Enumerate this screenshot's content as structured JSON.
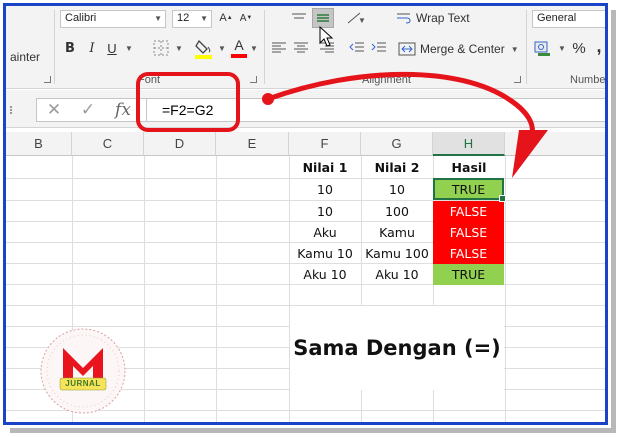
{
  "ribbon": {
    "font_name": "Calibri",
    "font_size": "12",
    "font_group_label": "Font",
    "alignment_group_label": "Alignment",
    "number_group_label": "Number",
    "painter_label": "ainter",
    "bold_label": "B",
    "italic_label": "I",
    "underline_label": "U",
    "font_color_label": "A",
    "wrap_text_label": "Wrap Text",
    "merge_center_label": "Merge & Center",
    "number_format": "General",
    "percent_label": "%",
    "comma_label": ","
  },
  "formula_bar": {
    "cancel_symbol": "✕",
    "enter_symbol": "✓",
    "fx_label": "fx",
    "formula": "=F2=G2"
  },
  "columns": [
    {
      "label": "B"
    },
    {
      "label": "C"
    },
    {
      "label": "D"
    },
    {
      "label": "E"
    },
    {
      "label": "F"
    },
    {
      "label": "G"
    },
    {
      "label": "H"
    }
  ],
  "table": {
    "headers": [
      "Nilai 1",
      "Nilai 2",
      "Hasil"
    ],
    "rows": [
      {
        "f": "10",
        "g": "10",
        "h": "TRUE"
      },
      {
        "f": "10",
        "g": "100",
        "h": "FALSE"
      },
      {
        "f": "Aku",
        "g": "Kamu",
        "h": "FALSE"
      },
      {
        "f": "Kamu 10",
        "g": "Kamu 100",
        "h": "FALSE"
      },
      {
        "f": "Aku 10",
        "g": "Aku 10",
        "h": "TRUE"
      }
    ]
  },
  "caption": "Sama Dengan (=)",
  "logo": {
    "letter": "M",
    "banner": "JURNAL"
  },
  "colors": {
    "true_fill": "#92d050",
    "false_fill": "#ff0000",
    "highlight_red": "#e5141b",
    "frame_blue": "#1a44c8",
    "excel_green": "#217346"
  }
}
